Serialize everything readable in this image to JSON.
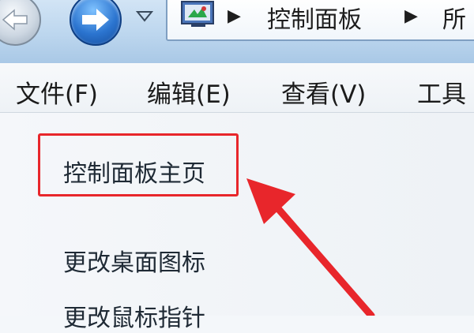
{
  "nav": {
    "back_icon": "back-arrow-icon",
    "forward_icon": "forward-arrow-icon",
    "history_icon": "chevron-down-icon"
  },
  "address": {
    "icon": "control-panel-icon",
    "separator": "▶",
    "crumbs": [
      "控制面板",
      "所"
    ]
  },
  "menu": {
    "items": [
      "文件(F)",
      "编辑(E)",
      "查看(V)",
      "工具"
    ]
  },
  "tasks": {
    "items": [
      "控制面板主页",
      "更改桌面图标",
      "更改鼠标指针"
    ]
  },
  "annotation": {
    "color": "#e8262b"
  }
}
